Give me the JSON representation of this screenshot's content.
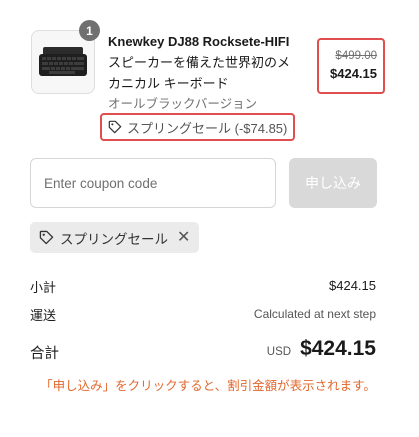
{
  "product": {
    "quantity": "1",
    "title_bold": "Knewkey DJ88 Rocksete-HIFI",
    "title_rest": " スピーカーを備えた世界初のメカニカル キーボード",
    "variant": "オールブラックバージョン",
    "price_original": "$499.00",
    "price_sale": "$424.15",
    "discount_line": "スプリングセール (-$74.85)"
  },
  "coupon": {
    "placeholder": "Enter coupon code",
    "value": "",
    "apply_label": "申し込み"
  },
  "applied_discount": {
    "label": "スプリングセール"
  },
  "summary": {
    "subtotal_label": "小計",
    "subtotal_value": "$424.15",
    "shipping_label": "運送",
    "shipping_value": "Calculated at next step",
    "total_label": "合計",
    "currency": "USD",
    "total_value": "$424.15"
  },
  "notice": "「申し込み」をクリックすると、割引金額が表示されます。",
  "colors": {
    "highlight": "#e04e4e",
    "notice": "#e2682e",
    "apply_disabled": "#d9d9d9"
  },
  "icons": [
    "keyboard-image",
    "tag-icon",
    "close-icon"
  ]
}
